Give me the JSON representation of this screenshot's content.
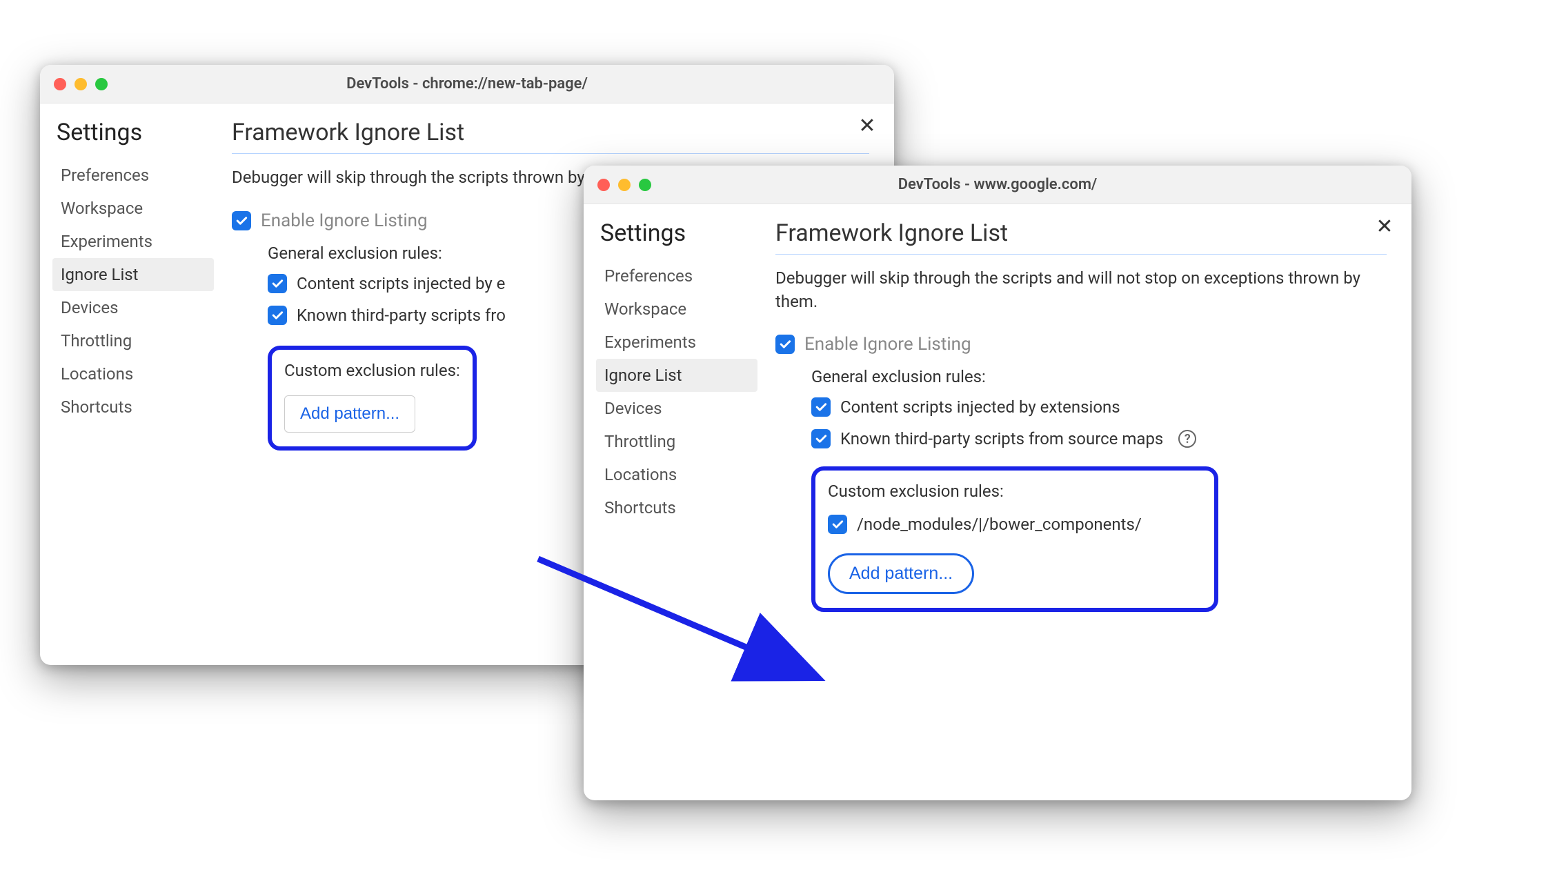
{
  "sidebar": {
    "title": "Settings",
    "items": [
      {
        "label": "Preferences"
      },
      {
        "label": "Workspace"
      },
      {
        "label": "Experiments"
      },
      {
        "label": "Ignore List",
        "selected": true
      },
      {
        "label": "Devices"
      },
      {
        "label": "Throttling"
      },
      {
        "label": "Locations"
      },
      {
        "label": "Shortcuts"
      }
    ]
  },
  "main": {
    "header": "Framework Ignore List",
    "enable_label": "Enable Ignore Listing",
    "general_rules_title": "General exclusion rules:",
    "rule_content_scripts": "Content scripts injected by extensions",
    "rule_known_third_party": "Known third-party scripts from source maps",
    "custom_rules_title": "Custom exclusion rules:",
    "add_pattern_label": "Add pattern..."
  },
  "window1": {
    "title": "DevTools - chrome://new-tab-page/",
    "description_visible": "Debugger will skip through the scripts thrown by them.",
    "rule_content_visible": "Content scripts injected by e",
    "rule_third_party_visible": "Known third-party scripts fro"
  },
  "window2": {
    "title": "DevTools - www.google.com/",
    "description": "Debugger will skip through the scripts and will not stop on exceptions thrown by them.",
    "custom_pattern": "/node_modules/|/bower_components/"
  }
}
